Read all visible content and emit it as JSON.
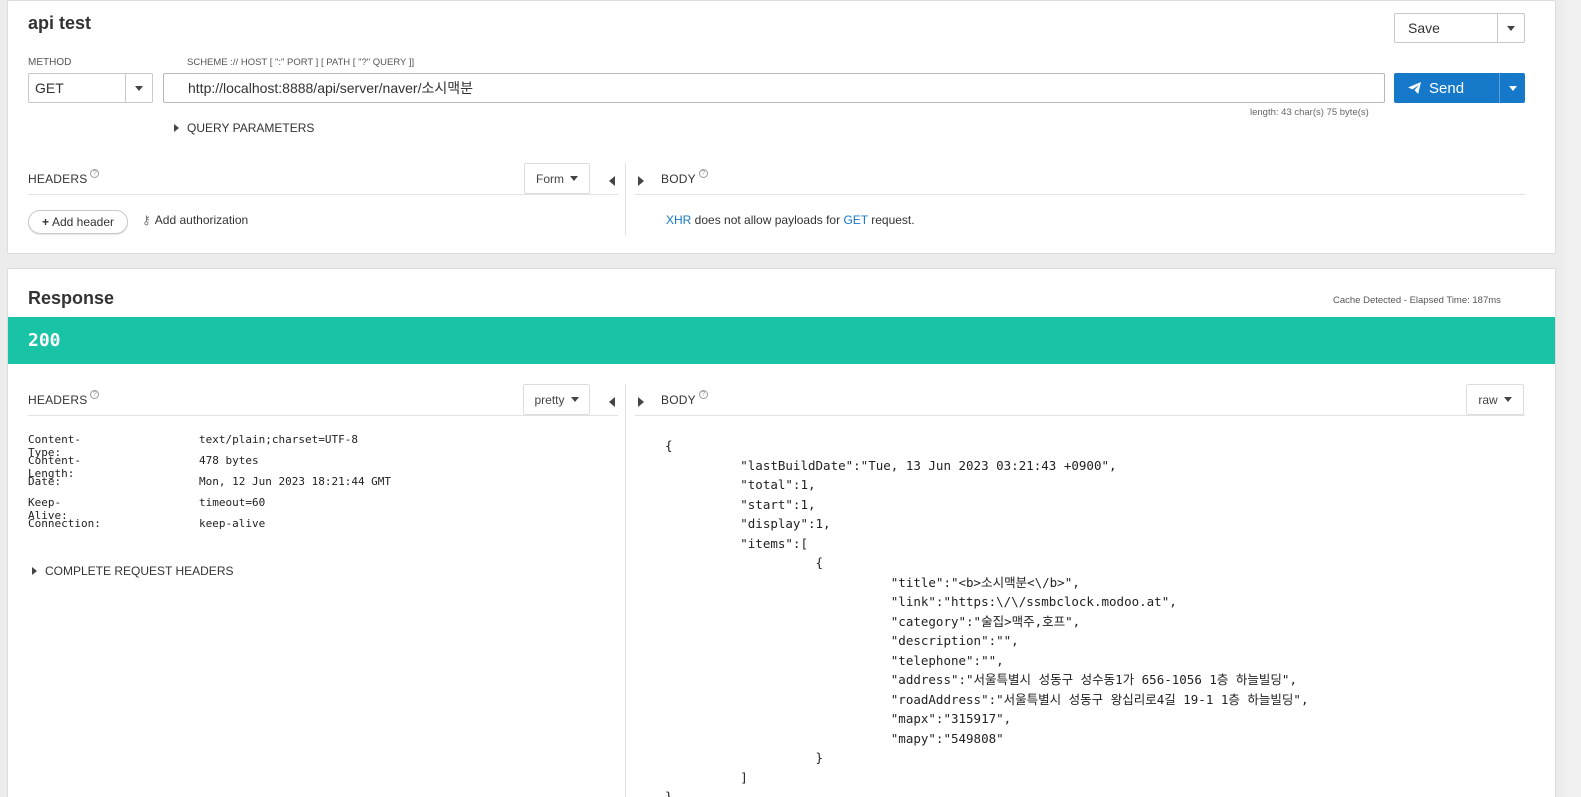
{
  "request": {
    "title": "api test",
    "save_label": "Save",
    "method_label": "METHOD",
    "method_value": "GET",
    "scheme_hint": "SCHEME :// HOST [ \":\" PORT ] [ PATH [ \"?\" QUERY ]]",
    "url_value": "http://localhost:8888/api/server/naver/소시맥분",
    "send_label": "Send",
    "length_info": "length: 43 char(s) 75 byte(s)",
    "query_params_label": "QUERY PARAMETERS",
    "headers_label": "HEADERS",
    "help_glyph": "?",
    "form_label": "Form",
    "body_label": "BODY",
    "add_header_plus": "+",
    "add_header_label": "Add header",
    "key_glyph": "⚷",
    "add_auth_label": "Add authorization",
    "xhr_link": "XHR",
    "xhr_mid": " does not allow payloads for ",
    "get_link": "GET",
    "xhr_end": " request."
  },
  "response": {
    "title": "Response",
    "elapsed": "Cache Detected - Elapsed Time: 187ms",
    "status_code": "200",
    "headers_label": "HEADERS",
    "pretty_label": "pretty",
    "body_label": "BODY",
    "raw_label": "raw",
    "headers": [
      {
        "key": "Content-Type:",
        "value": "text/plain;charset=UTF-8"
      },
      {
        "key": "Content-Length:",
        "value": "478 bytes"
      },
      {
        "key": "Date:",
        "value": "Mon, 12 Jun 2023 18:21:44 GMT"
      },
      {
        "key": "Keep-Alive:",
        "value": "timeout=60"
      },
      {
        "key": "Connection:",
        "value": "keep-alive"
      }
    ],
    "complete_headers_label": "COMPLETE REQUEST HEADERS",
    "body_text": "{\n          \"lastBuildDate\":\"Tue, 13 Jun 2023 03:21:43 +0900\",\n          \"total\":1,\n          \"start\":1,\n          \"display\":1,\n          \"items\":[\n                    {\n                              \"title\":\"<b>소시맥분<\\/b>\",\n                              \"link\":\"https:\\/\\/ssmbclock.modoo.at\",\n                              \"category\":\"술집>맥주,호프\",\n                              \"description\":\"\",\n                              \"telephone\":\"\",\n                              \"address\":\"서울특별시 성동구 성수동1가 656-1056 1층 하늘빌딩\",\n                              \"roadAddress\":\"서울특별시 성동구 왕십리로4길 19-1 1층 하늘빌딩\",\n                              \"mapx\":\"315917\",\n                              \"mapy\":\"549808\"\n                    }\n          ]\n}"
  },
  "colors": {
    "accent": "#1678c8",
    "status_ok": "#19c3a6"
  }
}
